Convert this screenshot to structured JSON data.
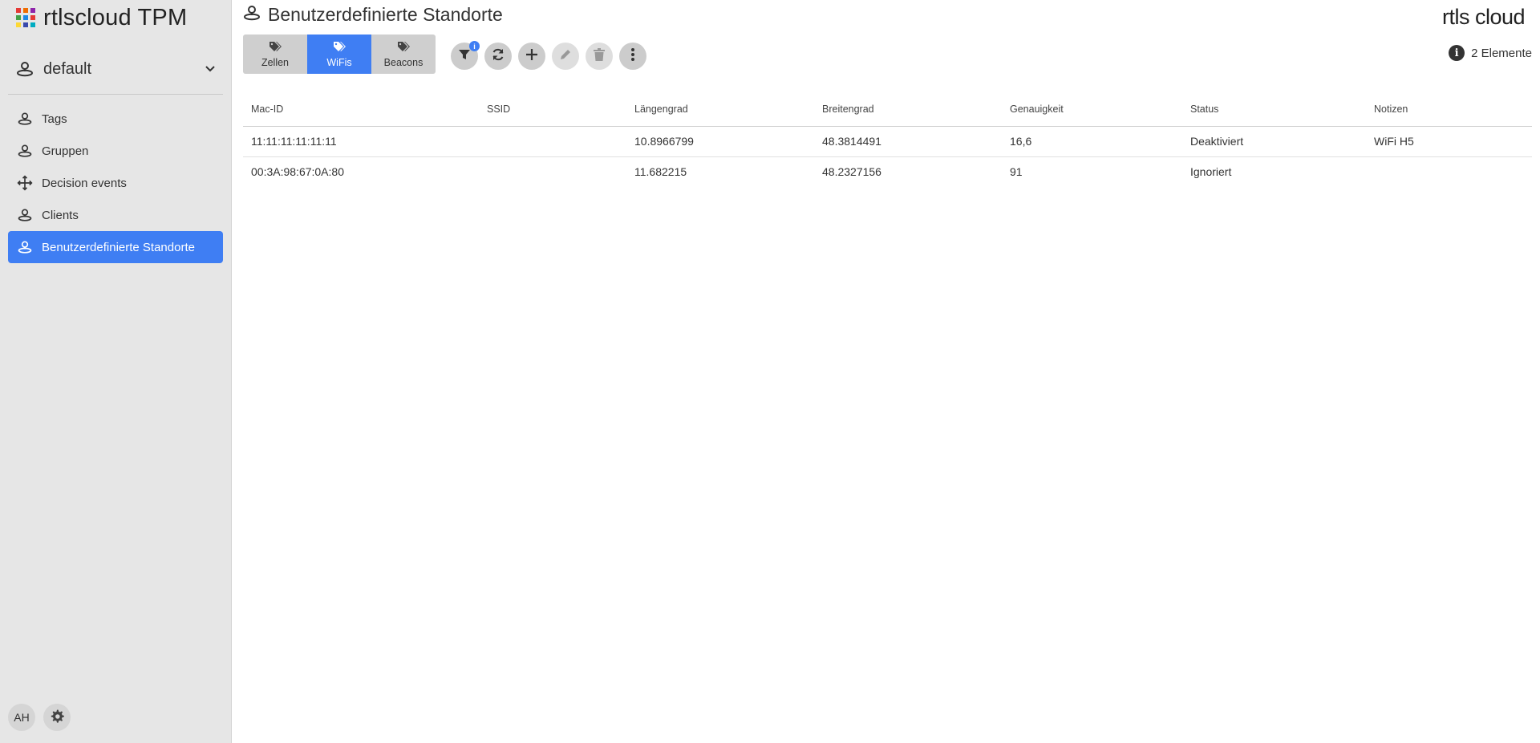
{
  "app": {
    "title": "rtlscloud TPM",
    "logo_colors": [
      "#e53935",
      "#ef6c00",
      "#8e24aa",
      "#43a047",
      "#1e88e5",
      "#e53935",
      "#fdd835",
      "#3949ab",
      "#00acc1"
    ]
  },
  "sidebar": {
    "workspace": {
      "label": "default",
      "icon": "location-pin-icon"
    },
    "items": [
      {
        "label": "Tags",
        "icon": "location-pin-icon",
        "active": false
      },
      {
        "label": "Gruppen",
        "icon": "location-pin-icon",
        "active": false
      },
      {
        "label": "Decision events",
        "icon": "arrows-move-icon",
        "active": false
      },
      {
        "label": "Clients",
        "icon": "location-pin-icon",
        "active": false
      },
      {
        "label": "Benutzerdefinierte Standorte",
        "icon": "location-pin-icon",
        "active": true
      }
    ],
    "user_initials": "AH",
    "accent": "#3f7ef3"
  },
  "header": {
    "title": "Benutzerdefinierte Standorte",
    "brand_logo": "rtls cloud",
    "item_count": "2 Elemente"
  },
  "tabs": [
    {
      "label": "Zellen",
      "icon": "tags-icon",
      "active": false
    },
    {
      "label": "WiFis",
      "icon": "tags-icon",
      "active": true
    },
    {
      "label": "Beacons",
      "icon": "tags-icon",
      "active": false
    }
  ],
  "toolbar": {
    "filter_badge": "i",
    "buttons": [
      "filter-icon",
      "refresh-icon",
      "plus-icon",
      "pencil-icon",
      "trash-icon",
      "more-vertical-icon"
    ]
  },
  "table": {
    "columns": [
      "Mac-ID",
      "SSID",
      "Längengrad",
      "Breitengrad",
      "Genauigkeit",
      "Status",
      "Notizen"
    ],
    "rows": [
      [
        "11:11:11:11:11:11",
        "",
        "10.8966799",
        "48.3814491",
        "16,6",
        "Deaktiviert",
        "WiFi H5"
      ],
      [
        "00:3A:98:67:0A:80",
        "",
        "11.682215",
        "48.2327156",
        "91",
        "Ignoriert",
        ""
      ]
    ]
  }
}
